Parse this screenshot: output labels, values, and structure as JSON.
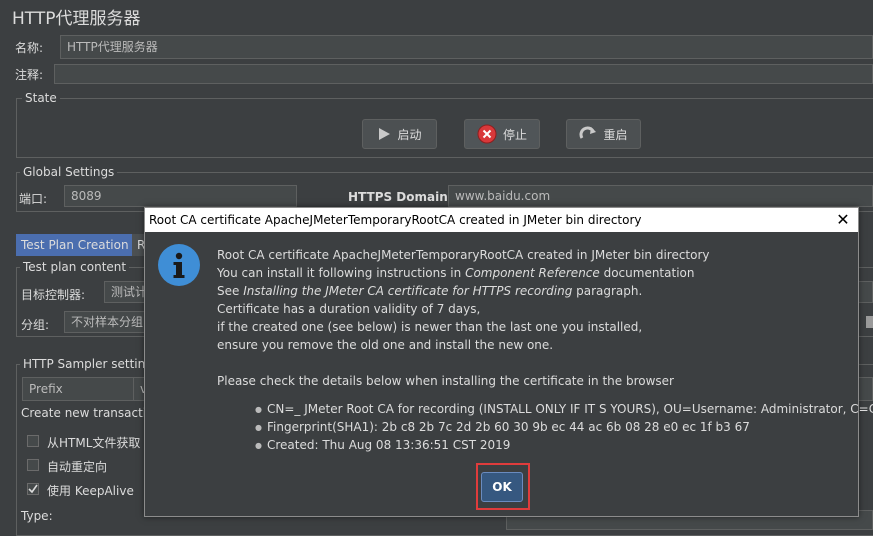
{
  "page": {
    "title": "HTTP代理服务器"
  },
  "form": {
    "name_label": "名称:",
    "name_value": "HTTP代理服务器",
    "comment_label": "注释:"
  },
  "state": {
    "group_title": "State",
    "start_label": "启动",
    "stop_label": "停止",
    "restart_label": "重启"
  },
  "global": {
    "group_title": "Global Settings",
    "port_label": "端口:",
    "port_value": "8089",
    "https_label": "HTTPS Domains:",
    "https_value": "www.baidu.com"
  },
  "tabs": [
    {
      "label": "Test Plan Creation",
      "active": true
    },
    {
      "label": "R"
    }
  ],
  "test_plan": {
    "group_title": "Test plan content",
    "target_label": "目标控制器:",
    "target_value": "测试计",
    "grouping_label": "分组:",
    "grouping_value": "不对样本分组"
  },
  "sampler": {
    "group_title": "HTTP Sampler setting",
    "prefix_value": "Prefix",
    "prefix_arrow": "v",
    "create_label": "Create new transactio",
    "checkbox_html": "从HTML文件获取",
    "checkbox_redirect": "自动重定向",
    "checkbox_keepalive": "使用 KeepAlive",
    "type_label": "Type:"
  },
  "dialog": {
    "title": "Root CA certificate ApacheJMeterTemporaryRootCA created in JMeter bin directory",
    "close": "✕",
    "line1": "Root CA certificate ApacheJMeterTemporaryRootCA created in JMeter bin directory",
    "line2a": "You can install it following instructions in ",
    "line2b": "Component Reference",
    "line2c": " documentation",
    "line3a": "See ",
    "line3b": "Installing the JMeter CA certificate for HTTPS recording",
    "line3c": " paragraph.",
    "line4": "Certificate has a duration validity of 7 days,",
    "line5": "if the created one (see below) is newer than the last one you installed,",
    "line6": "ensure you remove the old one and install the new one.",
    "line7": "Please check the details below when installing the certificate in the browser",
    "bullet1": "CN=_ JMeter Root CA for recording (INSTALL ONLY IF IT S YOURS), OU=Username: Administrator, C=CN",
    "bullet2": "Fingerprint(SHA1): 2b c8 2b 7c 2d 2b 60 30 9b ec 44 ac 6b 08 28 e0 ec 1f b3 67",
    "bullet3": "Created: Thu Aug 08 13:36:51 CST 2019",
    "ok_label": "OK"
  },
  "colors": {
    "background": "#3c3f41",
    "accent_tab": "#4b6eaf",
    "info_icon": "#3f8ed6",
    "stop_icon": "#d9383a",
    "highlight": "#e03c3c"
  }
}
